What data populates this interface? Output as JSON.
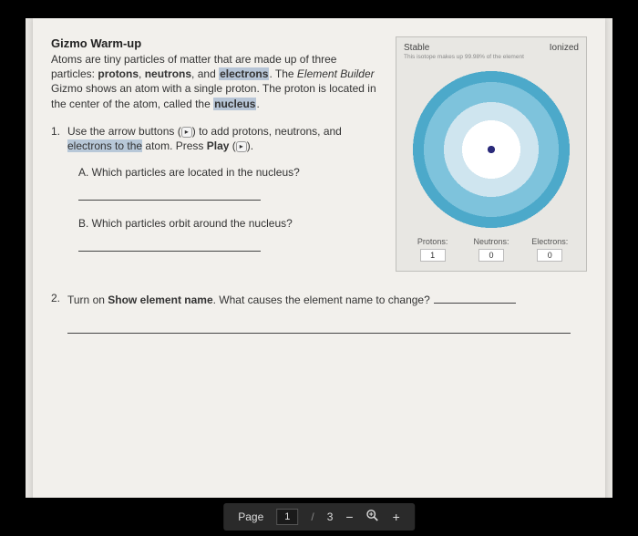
{
  "doc": {
    "title": "Gizmo Warm-up",
    "intro_pre": "Atoms are tiny particles of matter that are made up of three particles: ",
    "intro_b1": "protons",
    "intro_c1": ", ",
    "intro_b2": "neutrons",
    "intro_c2": ", and ",
    "intro_b3": "electrons",
    "intro_post1": ". The ",
    "intro_i1": "Element Builder",
    "intro_post2": " Gizmo shows an atom with a single proton. The proton is located in the center of the atom, called the ",
    "intro_b4": "nucleus",
    "intro_post3": ".",
    "q1_num": "1.",
    "q1_text_a": "Use the arrow buttons (",
    "q1_icon1": "▸",
    "q1_text_b": ") to add protons, neutrons, and ",
    "q1_hl": "electrons to the",
    "q1_text_c": " atom. Press ",
    "q1_b": "Play",
    "q1_text_d": " (",
    "q1_icon2": "▸",
    "q1_text_e": ").",
    "q1a_label": "A.  Which particles are located in the nucleus?",
    "q1b_label": "B.  Which particles orbit around the nucleus?",
    "q2_num": "2.",
    "q2_text_a": "Turn on ",
    "q2_b": "Show element name",
    "q2_text_b": ". What causes the element name to change?"
  },
  "panel": {
    "stable": "Stable",
    "ionized": "Ionized",
    "subtitle": "This isotope makes up 99.98% of the element",
    "protons_label": "Protons:",
    "neutrons_label": "Neutrons:",
    "electrons_label": "Electrons:",
    "protons_val": "1",
    "neutrons_val": "0",
    "electrons_val": "0"
  },
  "toolbar": {
    "page_label": "Page",
    "current": "1",
    "sep": "/",
    "total": "3",
    "minus": "−",
    "zoom_icon": "⊕",
    "plus": "+"
  }
}
